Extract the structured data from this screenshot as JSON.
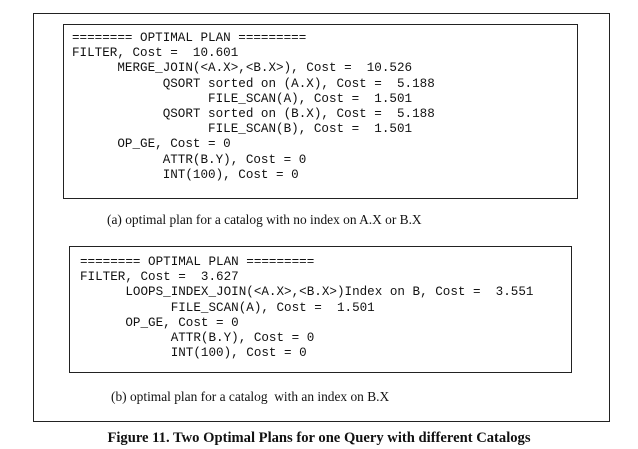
{
  "plan_a": {
    "lines": [
      "======== OPTIMAL PLAN =========",
      "FILTER, Cost =  10.601",
      "      MERGE_JOIN(<A.X>,<B.X>), Cost =  10.526",
      "            QSORT sorted on (A.X), Cost =  5.188",
      "                  FILE_SCAN(A), Cost =  1.501",
      "            QSORT sorted on (B.X), Cost =  5.188",
      "                  FILE_SCAN(B), Cost =  1.501",
      "      OP_GE, Cost = 0",
      "            ATTR(B.Y), Cost = 0",
      "            INT(100), Cost = 0"
    ],
    "caption": "(a) optimal plan for a catalog with no index on A.X or B.X"
  },
  "plan_b": {
    "lines": [
      "======== OPTIMAL PLAN =========",
      "FILTER, Cost =  3.627",
      "      LOOPS_INDEX_JOIN(<A.X>,<B.X>)Index on B, Cost =  3.551",
      "            FILE_SCAN(A), Cost =  1.501",
      "      OP_GE, Cost = 0",
      "            ATTR(B.Y), Cost = 0",
      "            INT(100), Cost = 0"
    ],
    "caption": "(b) optimal plan for a catalog  with an index on B.X"
  },
  "figure_caption": "Figure 11. Two Optimal Plans for one Query with different Catalogs"
}
